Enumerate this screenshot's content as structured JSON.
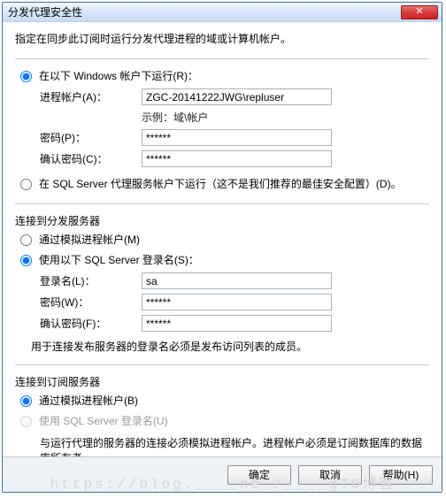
{
  "title": "分发代理安全性",
  "close_x": "✕",
  "intro": "指定在同步此订阅时运行分发代理进程的域或计算机帐户。",
  "top": {
    "opt_windows": "在以下 Windows 帐户下运行(R)：",
    "process_account_label": "进程帐户(A)：",
    "process_account_value": "ZGC-20141222JWG\\repluser",
    "example": "示例：域\\帐户",
    "password_label": "密码(P)：",
    "password_value": "******",
    "confirm_label": "确认密码(C)：",
    "confirm_value": "******",
    "opt_sqlagent": "在 SQL Server 代理服务帐户下运行（这不是我们推荐的最佳安全配置）(D)。"
  },
  "dist": {
    "title": "连接到分发服务器",
    "opt_impersonate": "通过模拟进程帐户(M)",
    "opt_sqllogin": "使用以下 SQL Server 登录名(S)：",
    "login_label": "登录名(L)：",
    "login_value": "sa",
    "password_label": "密码(W)：",
    "password_value": "******",
    "confirm_label": "确认密码(F)：",
    "confirm_value": "******",
    "note": "用于连接发布服务器的登录名必须是发布访问列表的成员。"
  },
  "sub": {
    "title": "连接到订阅服务器",
    "opt_impersonate": "通过模拟进程帐户(B)",
    "opt_sqllogin": "使用 SQL Server 登录名(U)",
    "note": "与运行代理的服务器的连接必须模拟进程帐户。进程帐户必须是订阅数据库的数据库所有者。"
  },
  "buttons": {
    "ok": "确定",
    "cancel": "取消",
    "help": "帮助(H)"
  },
  "watermark": "https://blog.____ne_/____gTO博客"
}
